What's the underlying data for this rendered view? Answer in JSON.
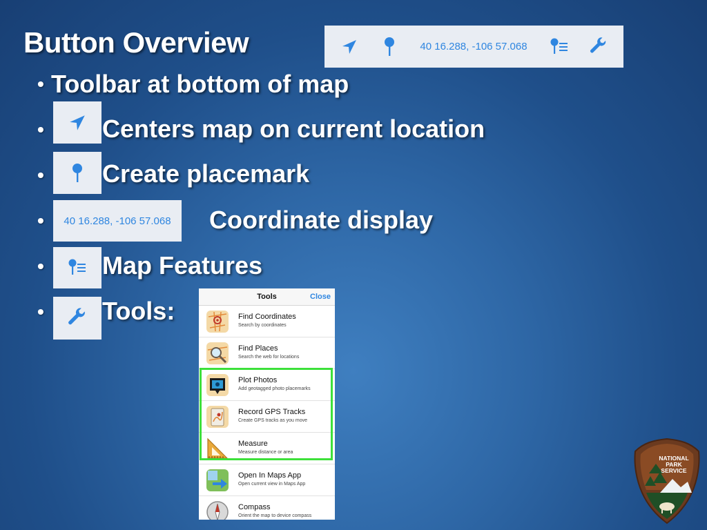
{
  "slide": {
    "title": "Button Overview"
  },
  "toolbar": {
    "coordinates": "40 16.288, -106 57.068",
    "icons": [
      "location-arrow-icon",
      "placemark-pin-icon",
      "map-features-icon",
      "wrench-icon"
    ],
    "accent_color": "#2f86e0"
  },
  "bullets": [
    {
      "text": "Toolbar at bottom of map"
    },
    {
      "text": "Centers map on current location",
      "icon": "location-arrow-icon"
    },
    {
      "text": "Create placemark",
      "icon": "placemark-pin-icon"
    },
    {
      "text": "Coordinate display",
      "icon_text": "40 16.288, -106 57.068"
    },
    {
      "text": "Map Features",
      "icon": "map-features-icon"
    },
    {
      "text": "Tools:",
      "icon": "wrench-icon"
    }
  ],
  "tools_panel": {
    "title": "Tools",
    "close_label": "Close",
    "items": [
      {
        "name": "Find Coordinates",
        "desc": "Search by coordinates",
        "icon": "find-coordinates-icon"
      },
      {
        "name": "Find Places",
        "desc": "Search the web for locations",
        "icon": "find-places-icon"
      },
      {
        "name": "Plot Photos",
        "desc": "Add geotagged photo placemarks",
        "icon": "plot-photos-icon"
      },
      {
        "name": "Record GPS Tracks",
        "desc": "Create GPS tracks as you move",
        "icon": "record-gps-icon"
      },
      {
        "name": "Measure",
        "desc": "Measure distance or area",
        "icon": "measure-icon"
      },
      {
        "name": "Open In Maps App",
        "desc": "Open current view in Maps App",
        "icon": "open-maps-icon"
      },
      {
        "name": "Compass",
        "desc": "Orient the map to device compass",
        "icon": "compass-icon"
      }
    ],
    "highlight_color": "#3de03a"
  },
  "logo": {
    "text_lines": [
      "NATIONAL",
      "PARK",
      "SERVICE"
    ]
  }
}
